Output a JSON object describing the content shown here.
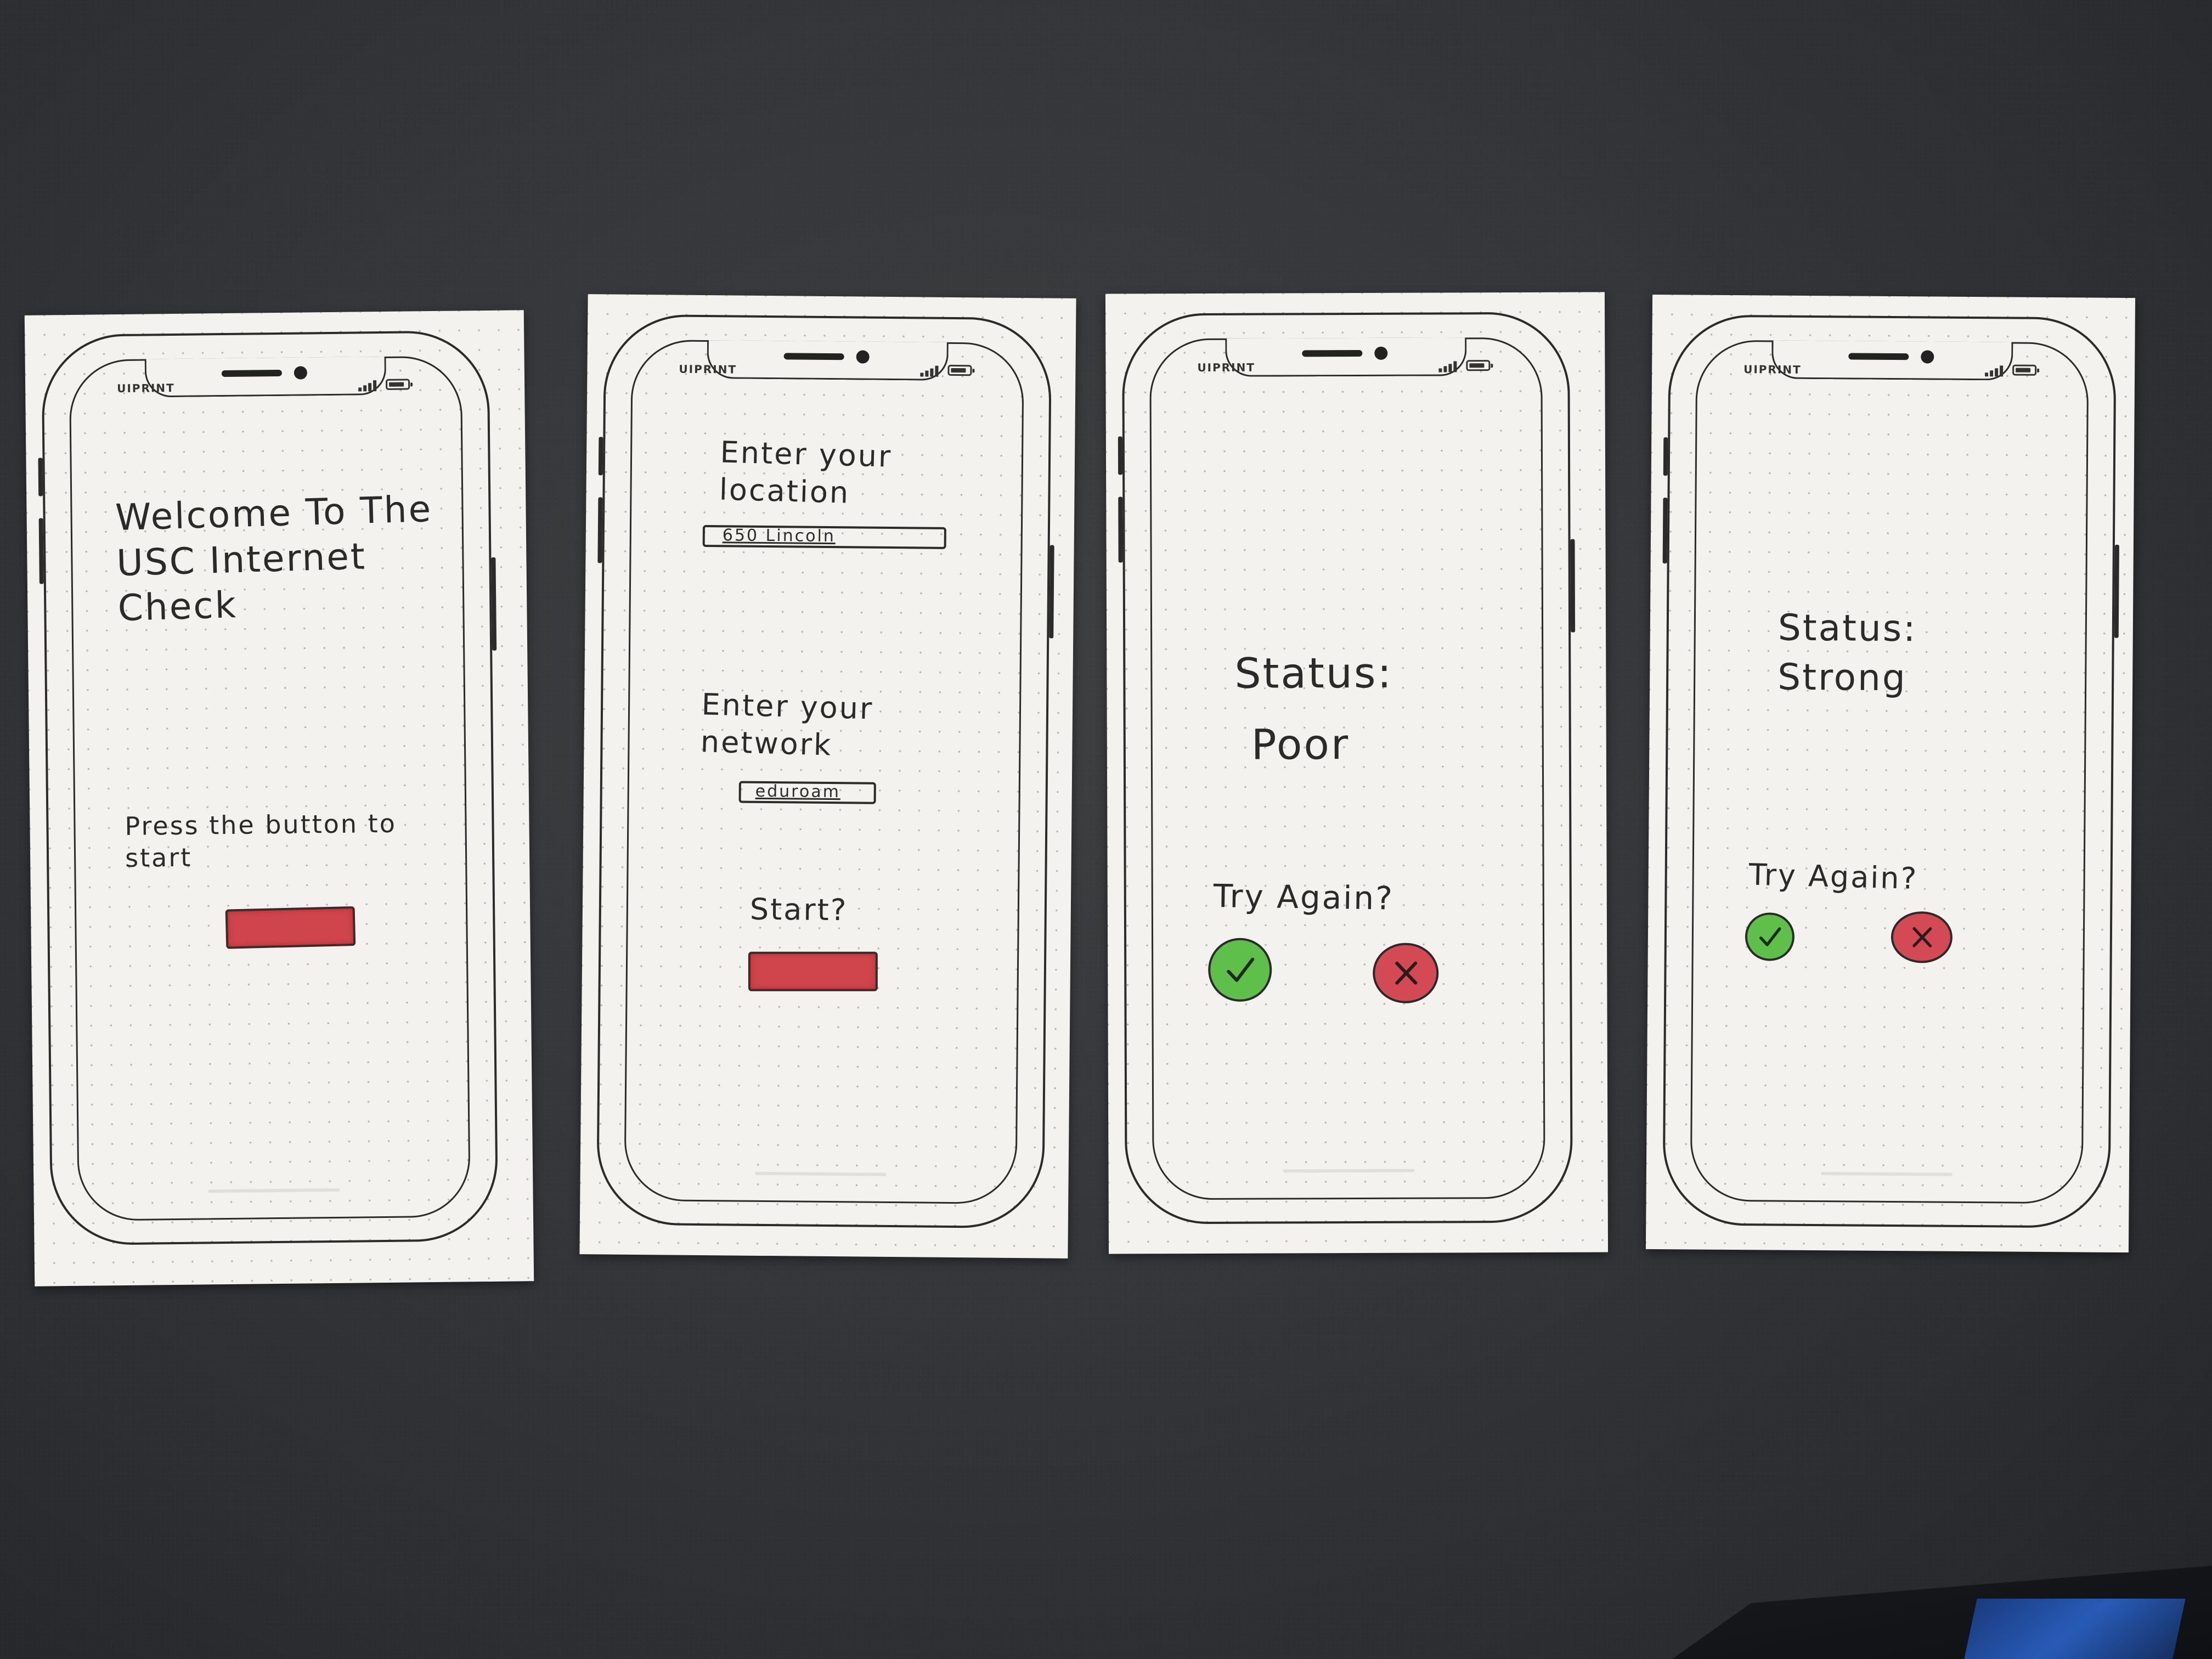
{
  "brand": "UIPRINT",
  "colors": {
    "accent_red": "#d0444b",
    "accept_green": "#5ec04a",
    "reject_red": "#d34a55",
    "paper": "#f3f2ee",
    "desk": "#34363a"
  },
  "screens": [
    {
      "title": "Welcome To The\nUSC Internet\nCheck",
      "instruction": "Press the button to\nstart"
    },
    {
      "location_prompt": "Enter your\nlocation",
      "location_value": "650 Lincoln",
      "network_prompt": "Enter your\nnetwork",
      "network_value": "eduroam",
      "start_label": "Start?"
    },
    {
      "status_label": "Status:",
      "status_value": "Poor",
      "retry_prompt": "Try Again?",
      "accept_icon": "checkmark-icon",
      "reject_icon": "x-icon"
    },
    {
      "status_label": "Status:",
      "status_value": "Strong",
      "retry_prompt": "Try Again?",
      "accept_icon": "checkmark-icon",
      "reject_icon": "x-icon"
    }
  ]
}
